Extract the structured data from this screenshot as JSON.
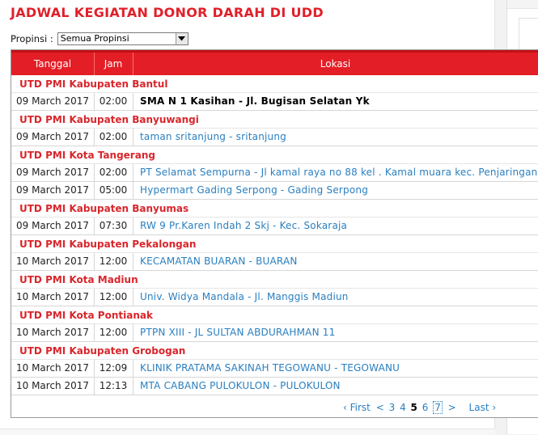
{
  "page": {
    "title": "JADWAL KEGIATAN DONOR DARAH DI UDD"
  },
  "filter": {
    "label": "Propinsi :",
    "selected": "Semua Propinsi"
  },
  "table": {
    "headers": {
      "date": "Tanggal",
      "time": "Jam",
      "location": "Lokasi"
    },
    "groups": [
      {
        "name": "UTD PMI Kabupaten Bantul",
        "rows": [
          {
            "date": "09 March 2017",
            "time": "02:00",
            "location": "SMA N 1 Kasihan - Jl. Bugisan Selatan Yk",
            "bold": true
          }
        ]
      },
      {
        "name": "UTD PMI Kabupaten Banyuwangi",
        "rows": [
          {
            "date": "09 March 2017",
            "time": "02:00",
            "location": "taman sritanjung - sritanjung"
          }
        ]
      },
      {
        "name": "UTD PMI Kota Tangerang",
        "rows": [
          {
            "date": "09 March 2017",
            "time": "02:00",
            "location": "PT Selamat Sempurna - Jl kamal raya no 88 kel . Kamal muara kec. Penjaringan"
          },
          {
            "date": "09 March 2017",
            "time": "05:00",
            "location": "Hypermart Gading Serpong - Gading Serpong"
          }
        ]
      },
      {
        "name": "UTD PMI Kabupaten Banyumas",
        "rows": [
          {
            "date": "09 March 2017",
            "time": "07:30",
            "location": "RW 9 Pr.Karen Indah 2 Skj - Kec. Sokaraja"
          }
        ]
      },
      {
        "name": "UTD PMI Kabupaten Pekalongan",
        "rows": [
          {
            "date": "10 March 2017",
            "time": "12:00",
            "location": "KECAMATAN BUARAN - BUARAN"
          }
        ]
      },
      {
        "name": "UTD PMI Kota Madiun",
        "rows": [
          {
            "date": "10 March 2017",
            "time": "12:00",
            "location": "Univ. Widya Mandala - Jl. Manggis Madiun"
          }
        ]
      },
      {
        "name": "UTD PMI Kota Pontianak",
        "rows": [
          {
            "date": "10 March 2017",
            "time": "12:00",
            "location": "PTPN XIII - JL SULTAN ABDURAHMAN 11"
          }
        ]
      },
      {
        "name": "UTD PMI Kabupaten Grobogan",
        "rows": [
          {
            "date": "10 March 2017",
            "time": "12:09",
            "location": "KLINIK PRATAMA SAKINAH TEGOWANU - TEGOWANU"
          },
          {
            "date": "10 March 2017",
            "time": "12:13",
            "location": "MTA CABANG PULOKULON - PULOKULON"
          }
        ]
      }
    ]
  },
  "pagination": {
    "first": "‹ First",
    "prev": "<",
    "pages": [
      "3",
      "4",
      "5",
      "6",
      "7"
    ],
    "current": "5",
    "focused": "7",
    "next": ">",
    "last": "Last ›"
  },
  "colors": {
    "accent": "#e41e26",
    "link": "#2a7fbf",
    "group_text": "#d9262c"
  },
  "icons": {
    "select_arrow": "triangle-down-icon"
  }
}
